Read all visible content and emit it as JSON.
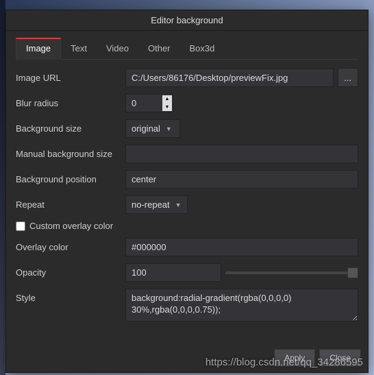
{
  "title": "Editor background",
  "tabs": [
    "Image",
    "Text",
    "Video",
    "Other",
    "Box3d"
  ],
  "active_tab": 0,
  "fields": {
    "image_url": {
      "label": "Image URL",
      "value": "C:/Users/86176/Desktop/previewFix.jpg",
      "browse": "..."
    },
    "blur_radius": {
      "label": "Blur radius",
      "value": "0"
    },
    "background_size": {
      "label": "Background size",
      "selected": "original"
    },
    "manual_bg_size": {
      "label": "Manual background size",
      "value": ""
    },
    "background_position": {
      "label": "Background position",
      "value": "center"
    },
    "repeat": {
      "label": "Repeat",
      "selected": "no-repeat"
    },
    "custom_overlay": {
      "label": "Custom overlay color",
      "checked": false
    },
    "overlay_color": {
      "label": "Overlay color",
      "value": "#000000"
    },
    "opacity": {
      "label": "Opacity",
      "value": "100"
    },
    "style": {
      "label": "Style",
      "value": "background:radial-gradient(rgba(0,0,0,0) 30%,rgba(0,0,0,0.75));"
    }
  },
  "buttons": {
    "apply": "Apply",
    "close": "Close"
  },
  "watermark": "https://blog.csdn.net/qq_34286595"
}
